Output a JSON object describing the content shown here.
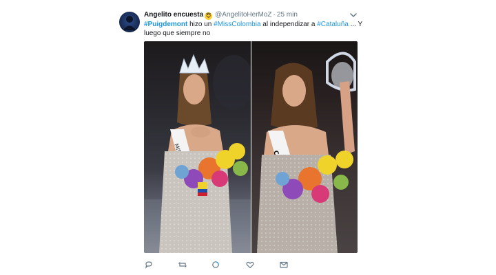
{
  "tweet": {
    "author_name": "Angelito encuesta",
    "emoji": "😇",
    "handle": "@AngelitoHerMoZ",
    "separator": "·",
    "time": "25 min",
    "text": {
      "hashtag1": "#Puigdemont",
      "part1": " hizo un ",
      "hashtag2": "#MissColombia",
      "part2": " al independizar a ",
      "hashtag3": "#Cataluña",
      "part3": " ... Y luego que siempre no"
    },
    "media": {
      "left_photo": "photo-crowned-contestant",
      "right_photo": "photo-crown-removed-contestant"
    }
  },
  "actions": {
    "reply_icon": "reply-icon",
    "retweet_icon": "retweet-icon",
    "like_icon": "heart-icon",
    "message_icon": "envelope-icon",
    "moments_icon": "moments-icon"
  },
  "colors": {
    "link": "#1b95e0",
    "muted": "#657786",
    "text": "#14171a"
  }
}
